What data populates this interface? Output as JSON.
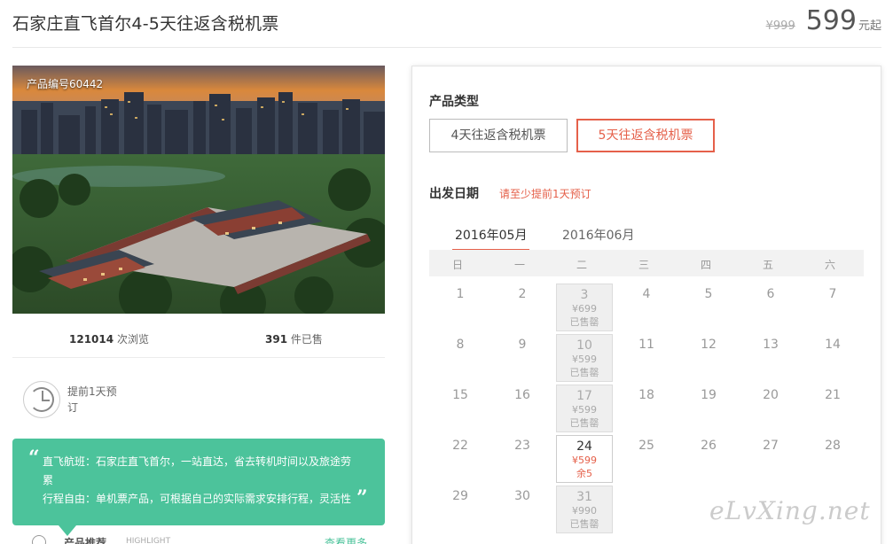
{
  "header": {
    "title": "石家庄直飞首尔4-5天往返含税机票",
    "old_price": "¥999",
    "price": "599",
    "price_suffix": "元起"
  },
  "hero": {
    "product_code": "产品编号60442"
  },
  "stats": {
    "views_count": "121014",
    "views_label": "次浏览",
    "sold_count": "391",
    "sold_label": "件已售"
  },
  "booking": {
    "note": "提前1天预订",
    "icon": "clock-icon"
  },
  "highlight": {
    "open_quote": "“",
    "close_quote": "”",
    "line1": "直飞航班：石家庄直飞首尔，一站直达，省去转机时间以及旅途劳累",
    "line2": "行程自由：单机票产品，可根据自己的实际需求安排行程，灵活性",
    "footer_title": "产品推荐",
    "footer_en": "HIGHLIGHT",
    "footer_more": "查看更多"
  },
  "panel": {
    "type_label": "产品类型",
    "types": [
      "4天往返含税机票",
      "5天往返含税机票"
    ],
    "selected_type": 1,
    "date_label": "出发日期",
    "date_note": "请至少提前1天预订",
    "months": [
      "2016年05月",
      "2016年06月"
    ],
    "selected_month": 0,
    "weekdays": [
      "日",
      "一",
      "二",
      "三",
      "四",
      "五",
      "六"
    ],
    "weeks": [
      [
        {
          "d": "1"
        },
        {
          "d": "2"
        },
        {
          "d": "3",
          "price": "¥699",
          "status": "已售罄",
          "state": "sold"
        },
        {
          "d": "4"
        },
        {
          "d": "5"
        },
        {
          "d": "6"
        },
        {
          "d": "7"
        }
      ],
      [
        {
          "d": "8"
        },
        {
          "d": "9"
        },
        {
          "d": "10",
          "price": "¥599",
          "status": "已售罄",
          "state": "sold"
        },
        {
          "d": "11"
        },
        {
          "d": "12"
        },
        {
          "d": "13"
        },
        {
          "d": "14"
        }
      ],
      [
        {
          "d": "15"
        },
        {
          "d": "16"
        },
        {
          "d": "17",
          "price": "¥599",
          "status": "已售罄",
          "state": "sold"
        },
        {
          "d": "18"
        },
        {
          "d": "19"
        },
        {
          "d": "20"
        },
        {
          "d": "21"
        }
      ],
      [
        {
          "d": "22"
        },
        {
          "d": "23"
        },
        {
          "d": "24",
          "price": "¥599",
          "status": "余5",
          "state": "open"
        },
        {
          "d": "25"
        },
        {
          "d": "26"
        },
        {
          "d": "27"
        },
        {
          "d": "28"
        }
      ],
      [
        {
          "d": "29"
        },
        {
          "d": "30"
        },
        {
          "d": "31",
          "price": "¥990",
          "status": "已售罄",
          "state": "sold"
        }
      ]
    ]
  },
  "watermark": "eLvXing.net",
  "colors": {
    "accent": "#e5604a",
    "highlight_bg": "#4cc39b"
  }
}
